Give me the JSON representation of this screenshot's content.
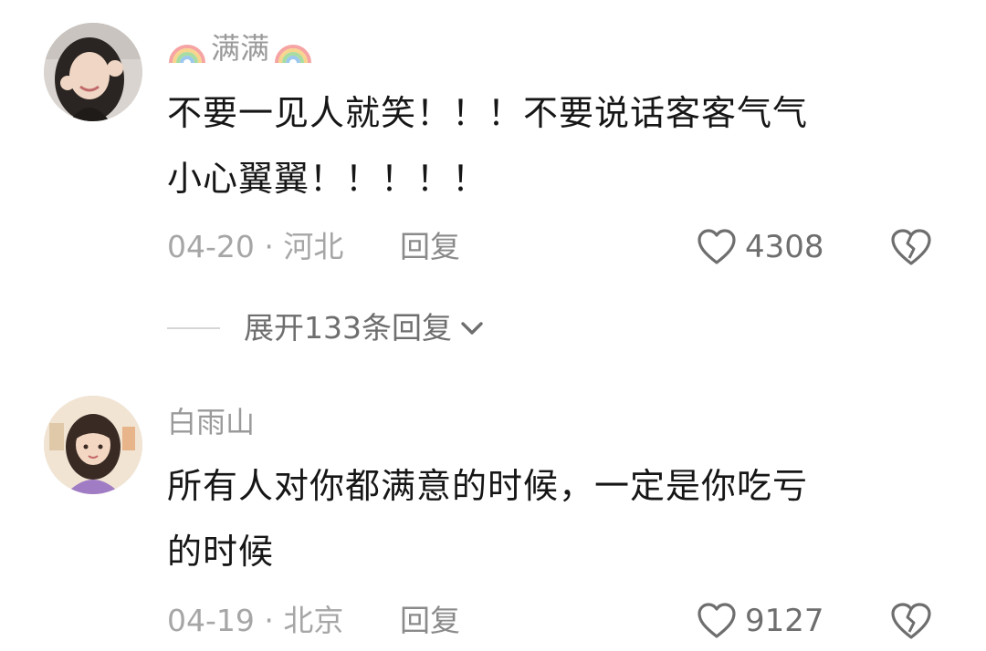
{
  "comments": [
    {
      "username": "满满",
      "text_line1": "不要一见人就笑！！！不要说话客客气气",
      "text_line2": "小心翼翼！！！！！",
      "date_location": "04-20 · 河北",
      "reply_label": "回复",
      "likes": "4308"
    },
    {
      "username": "白雨山",
      "text_line1": "所有人对你都满意的时候，一定是你吃亏",
      "text_line2": "的时候",
      "date_location": "04-19 · 北京",
      "reply_label": "回复",
      "likes": "9127"
    }
  ],
  "expand_replies": {
    "label": "展开133条回复"
  },
  "icons": {
    "like": "heart-outline-icon",
    "dislike": "broken-heart-icon",
    "expand": "chevron-down-icon",
    "username_decoration": "rainbow-icon"
  },
  "colors": {
    "text": "#161616",
    "muted": "#a6a6a6",
    "icon": "#6e6e6e"
  }
}
